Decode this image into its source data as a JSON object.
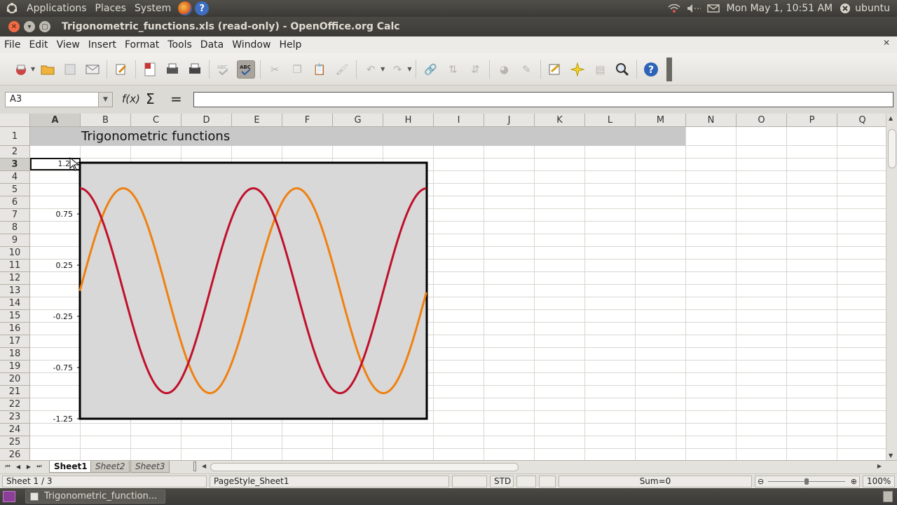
{
  "panel": {
    "menus": [
      "Applications",
      "Places",
      "System"
    ],
    "clock": "Mon May  1, 10:51 AM",
    "user": "ubuntu"
  },
  "window": {
    "title": "Trigonometric_functions.xls (read-only) - OpenOffice.org Calc"
  },
  "menubar": {
    "items": [
      "File",
      "Edit",
      "View",
      "Insert",
      "Format",
      "Tools",
      "Data",
      "Window",
      "Help"
    ]
  },
  "formula": {
    "name_box": "A3",
    "fx_label": "f(x)",
    "sum_label": "Σ",
    "eq_label": "=",
    "value": ""
  },
  "grid": {
    "columns": [
      "A",
      "B",
      "C",
      "D",
      "E",
      "F",
      "G",
      "H",
      "I",
      "J",
      "K",
      "L",
      "M",
      "N",
      "O",
      "P",
      "Q"
    ],
    "rows": [
      "1",
      "2",
      "3",
      "4",
      "5",
      "6",
      "7",
      "8",
      "9",
      "10",
      "11",
      "12",
      "13",
      "14",
      "15",
      "16",
      "17",
      "18",
      "19",
      "20",
      "21",
      "22",
      "23",
      "24",
      "25",
      "26"
    ],
    "selected_column": "A",
    "selected_row": "3",
    "title_cell": "Trigonometric functions",
    "a3_value": "1.25"
  },
  "chart_data": {
    "type": "line",
    "title": "",
    "xlabel": "",
    "ylabel": "",
    "ylim": [
      -1.25,
      1.25
    ],
    "yticks": [
      "1.25",
      "0.75",
      "0.25",
      "-0.25",
      "-0.75",
      "-1.25"
    ],
    "xlim": [
      0,
      12.566
    ],
    "grid": false,
    "legend": "none",
    "plot_bg": "#d8d8d8",
    "series": [
      {
        "function": "sin(x)",
        "color": "#f08010",
        "step": 0.1
      },
      {
        "function": "cos(x)",
        "color": "#c0102a",
        "step": 0.1
      }
    ]
  },
  "sheets": {
    "tabs": [
      "Sheet1",
      "Sheet2",
      "Sheet3"
    ],
    "active": "Sheet1"
  },
  "status": {
    "sheet": "Sheet 1 / 3",
    "page_style": "PageStyle_Sheet1",
    "mode": "STD",
    "sum": "Sum=0",
    "zoom": "100%"
  },
  "taskbar": {
    "task_label": "Trigonometric_function..."
  }
}
